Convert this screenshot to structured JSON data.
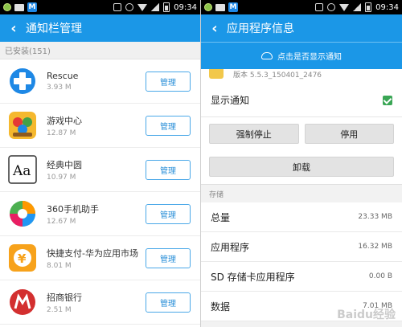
{
  "left": {
    "status": {
      "time": "09:34"
    },
    "header": {
      "title": "通知栏管理"
    },
    "section_label": "已安装(151)",
    "manage_label": "管理",
    "apps": [
      {
        "name": "Rescue",
        "size": "3.93 M",
        "icon": "rescue-cross-icon"
      },
      {
        "name": "游戏中心",
        "size": "12.87 M",
        "icon": "game-center-icon"
      },
      {
        "name": "经典中圆",
        "size": "10.97 M",
        "icon": "font-aa-icon"
      },
      {
        "name": "360手机助手",
        "size": "12.67 M",
        "icon": "360-assistant-icon"
      },
      {
        "name": "快捷支付-华为应用市场",
        "size": "8.01 M",
        "icon": "yuan-pay-icon"
      },
      {
        "name": "招商银行",
        "size": "2.51 M",
        "icon": "cmb-bank-icon"
      }
    ]
  },
  "right": {
    "status": {
      "time": "09:34"
    },
    "header": {
      "title": "应用程序信息"
    },
    "banner": {
      "text": "点击是否显示通知"
    },
    "version_text": "版本 5.5.3_150401_2476",
    "notify": {
      "label": "显示通知",
      "checked": true
    },
    "buttons": {
      "force_stop": "强制停止",
      "disable": "停用",
      "uninstall": "卸载"
    },
    "storage_label": "存储",
    "stats": [
      {
        "label": "总量",
        "value": "23.33 MB"
      },
      {
        "label": "应用程序",
        "value": "16.32 MB"
      },
      {
        "label": "SD 存储卡应用程序",
        "value": "0.00 B"
      },
      {
        "label": "数据",
        "value": "7.01 MB"
      }
    ]
  },
  "watermark": "Baidu经验",
  "colors": {
    "accent": "#1b97e7",
    "check": "#3aa655",
    "button_border": "#4aa8e8"
  }
}
